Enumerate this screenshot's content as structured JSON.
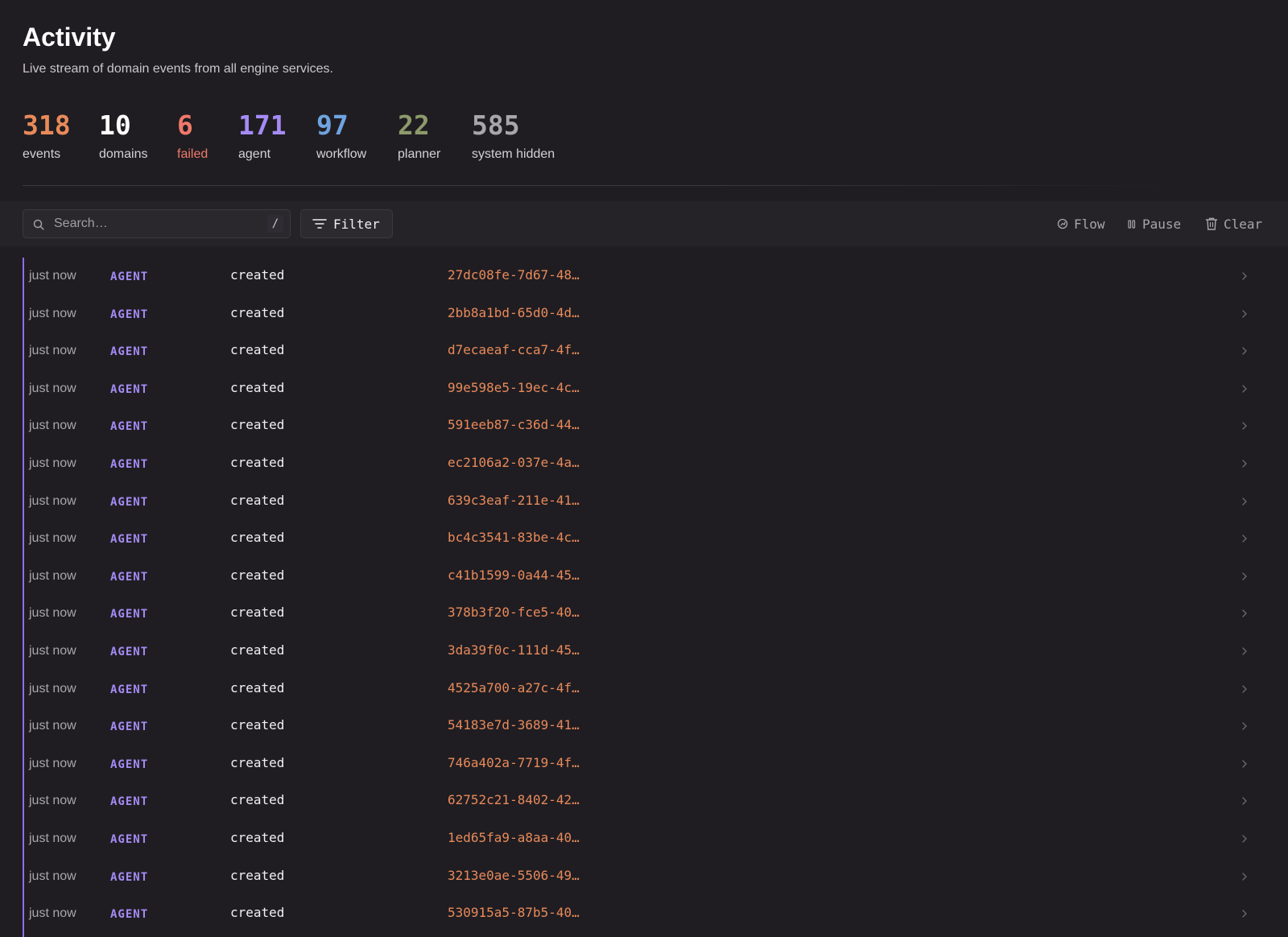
{
  "header": {
    "title": "Activity",
    "subtitle": "Live stream of domain events from all engine services."
  },
  "stats": [
    {
      "value": "318",
      "label": "events",
      "color": "#e98a5a",
      "label_color": "#d4d1d6"
    },
    {
      "value": "10",
      "label": "domains",
      "color": "#ffffff",
      "label_color": "#d4d1d6"
    },
    {
      "value": "6",
      "label": "failed",
      "color": "#f0796a",
      "label_color": "#f0796a"
    },
    {
      "value": "171",
      "label": "agent",
      "color": "#a58bf5",
      "label_color": "#d4d1d6"
    },
    {
      "value": "97",
      "label": "workflow",
      "color": "#6fa3e0",
      "label_color": "#d4d1d6"
    },
    {
      "value": "22",
      "label": "planner",
      "color": "#8d9a6a",
      "label_color": "#d4d1d6"
    },
    {
      "value": "585",
      "label": "system hidden",
      "color": "#a8a5ab",
      "label_color": "#d4d1d6"
    }
  ],
  "toolbar": {
    "search_placeholder": "Search…",
    "search_shortcut": "/",
    "filter_label": "Filter",
    "flow_label": "Flow",
    "pause_label": "Pause",
    "clear_label": "Clear"
  },
  "events": [
    {
      "time": "just now",
      "domain": "AGENT",
      "action": "created",
      "id": "27dc08fe-7d67-48…"
    },
    {
      "time": "just now",
      "domain": "AGENT",
      "action": "created",
      "id": "2bb8a1bd-65d0-4d…"
    },
    {
      "time": "just now",
      "domain": "AGENT",
      "action": "created",
      "id": "d7ecaeaf-cca7-4f…"
    },
    {
      "time": "just now",
      "domain": "AGENT",
      "action": "created",
      "id": "99e598e5-19ec-4c…"
    },
    {
      "time": "just now",
      "domain": "AGENT",
      "action": "created",
      "id": "591eeb87-c36d-44…"
    },
    {
      "time": "just now",
      "domain": "AGENT",
      "action": "created",
      "id": "ec2106a2-037e-4a…"
    },
    {
      "time": "just now",
      "domain": "AGENT",
      "action": "created",
      "id": "639c3eaf-211e-41…"
    },
    {
      "time": "just now",
      "domain": "AGENT",
      "action": "created",
      "id": "bc4c3541-83be-4c…"
    },
    {
      "time": "just now",
      "domain": "AGENT",
      "action": "created",
      "id": "c41b1599-0a44-45…"
    },
    {
      "time": "just now",
      "domain": "AGENT",
      "action": "created",
      "id": "378b3f20-fce5-40…"
    },
    {
      "time": "just now",
      "domain": "AGENT",
      "action": "created",
      "id": "3da39f0c-111d-45…"
    },
    {
      "time": "just now",
      "domain": "AGENT",
      "action": "created",
      "id": "4525a700-a27c-4f…"
    },
    {
      "time": "just now",
      "domain": "AGENT",
      "action": "created",
      "id": "54183e7d-3689-41…"
    },
    {
      "time": "just now",
      "domain": "AGENT",
      "action": "created",
      "id": "746a402a-7719-4f…"
    },
    {
      "time": "just now",
      "domain": "AGENT",
      "action": "created",
      "id": "62752c21-8402-42…"
    },
    {
      "time": "just now",
      "domain": "AGENT",
      "action": "created",
      "id": "1ed65fa9-a8aa-40…"
    },
    {
      "time": "just now",
      "domain": "AGENT",
      "action": "created",
      "id": "3213e0ae-5506-49…"
    },
    {
      "time": "just now",
      "domain": "AGENT",
      "action": "created",
      "id": "530915a5-87b5-40…"
    }
  ]
}
